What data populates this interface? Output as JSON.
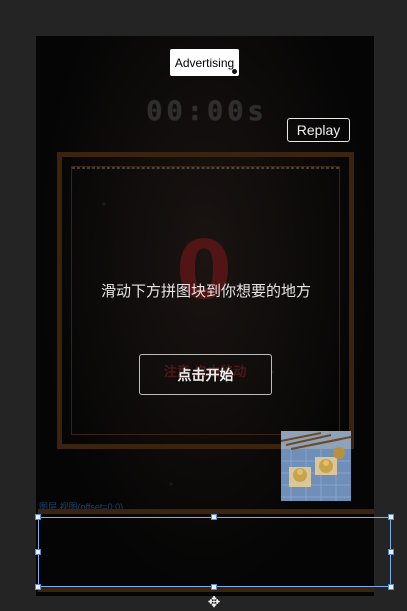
{
  "ad": {
    "label": "Advertising"
  },
  "timer": {
    "value": "00:00s"
  },
  "replay": {
    "label": "Replay"
  },
  "board": {
    "big_number": "0",
    "instruction": "滑动下方拼图块到你想要的地方",
    "faded_text": "注意  自由移动",
    "start_label": "点击开始"
  },
  "editor": {
    "selection_label": "图层 视图(offset=0,0)"
  },
  "icons": {
    "move": "move-icon"
  },
  "colors": {
    "frame_border": "#3a2410",
    "accent_red": "#5c1616",
    "selection": "#7aaee8"
  }
}
